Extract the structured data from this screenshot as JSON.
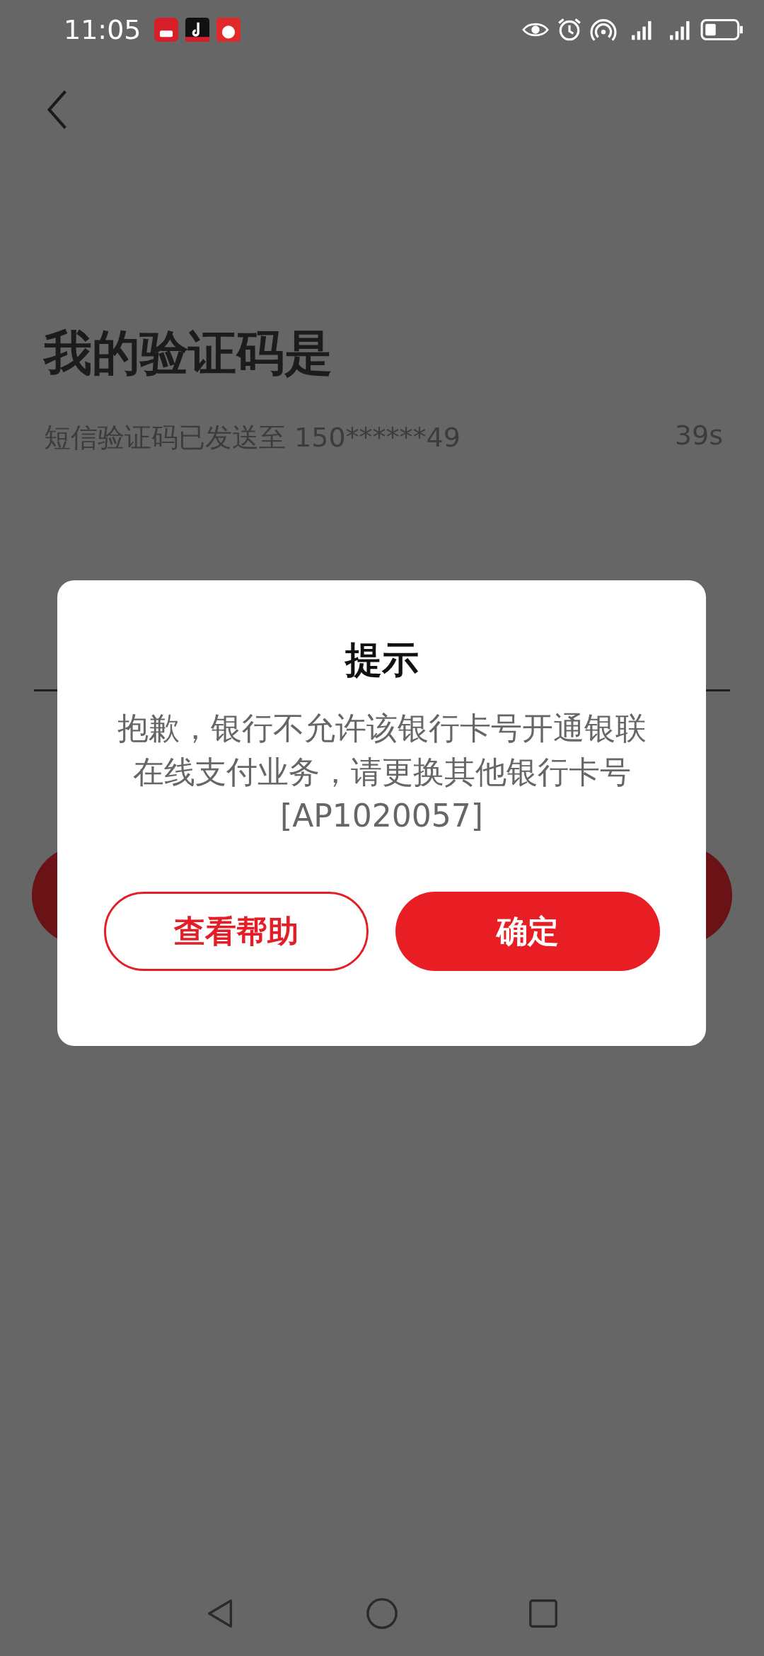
{
  "status_bar": {
    "time": "11:05"
  },
  "page": {
    "title": "我的验证码是",
    "sms_notice": "短信验证码已发送至 150******49",
    "countdown": "39s"
  },
  "dialog": {
    "title": "提示",
    "message": [
      "抱歉，银行不允许该银行卡号开通银联",
      "在线支付业务，请更换其他银行卡号",
      "[AP1020057]"
    ],
    "buttons": [
      {
        "label": "查看帮助",
        "kind": "secondary"
      },
      {
        "label": "确定",
        "kind": "primary"
      }
    ]
  }
}
